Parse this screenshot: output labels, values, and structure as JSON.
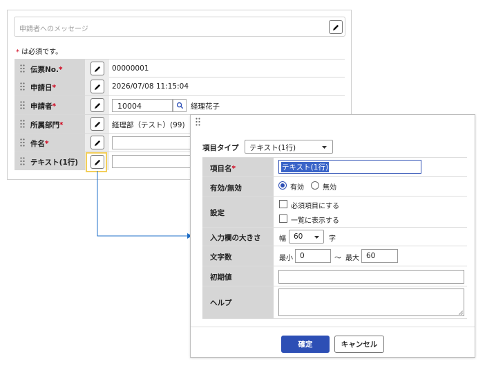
{
  "message": {
    "placeholder": "申請者へのメッセージ"
  },
  "required_note": {
    "star": "*",
    "text": " は必須です。"
  },
  "form_rows": [
    {
      "label": "伝票No.",
      "required": "*",
      "value": "00000001"
    },
    {
      "label": "申請日",
      "required": "*",
      "value": "2026/07/08 11:15:04"
    },
    {
      "label": "申請者",
      "required": "*",
      "input_value": "10004",
      "name": "経理花子"
    },
    {
      "label": "所属部門",
      "required": "*",
      "value": "経理部（テスト）(99)"
    },
    {
      "label": "件名",
      "required": "*",
      "value": ""
    },
    {
      "label": "テキスト(1行)",
      "required": "",
      "value": ""
    }
  ],
  "dialog": {
    "item_type_label": "項目タイプ",
    "item_type_value": "テキスト(1行)",
    "rows": {
      "item_name": {
        "label": "項目名",
        "required": "*",
        "value": "テキスト(1行)"
      },
      "enabled": {
        "label": "有効/無効",
        "option_on": "有効",
        "option_off": "無効",
        "selected": "有効"
      },
      "settings": {
        "label": "設定",
        "opt_required": "必須項目にする",
        "opt_list": "一覧に表示する"
      },
      "field_size": {
        "label": "入力欄の大きさ",
        "prefix": "幅",
        "value": "60",
        "unit": "字"
      },
      "char_count": {
        "label": "文字数",
        "min_label": "最小",
        "min_value": "0",
        "tilde": "〜",
        "max_label": "最大",
        "max_value": "60"
      },
      "initial": {
        "label": "初期値",
        "value": ""
      },
      "help": {
        "label": "ヘルプ",
        "value": ""
      }
    },
    "confirm_label": "確定",
    "cancel_label": "キャンセル"
  },
  "colors": {
    "primary": "#2d4fb5",
    "required": "#d0021b",
    "highlight": "#f3cf5b",
    "connector": "#1f6fc8",
    "label_bg": "#d6d6d6"
  }
}
